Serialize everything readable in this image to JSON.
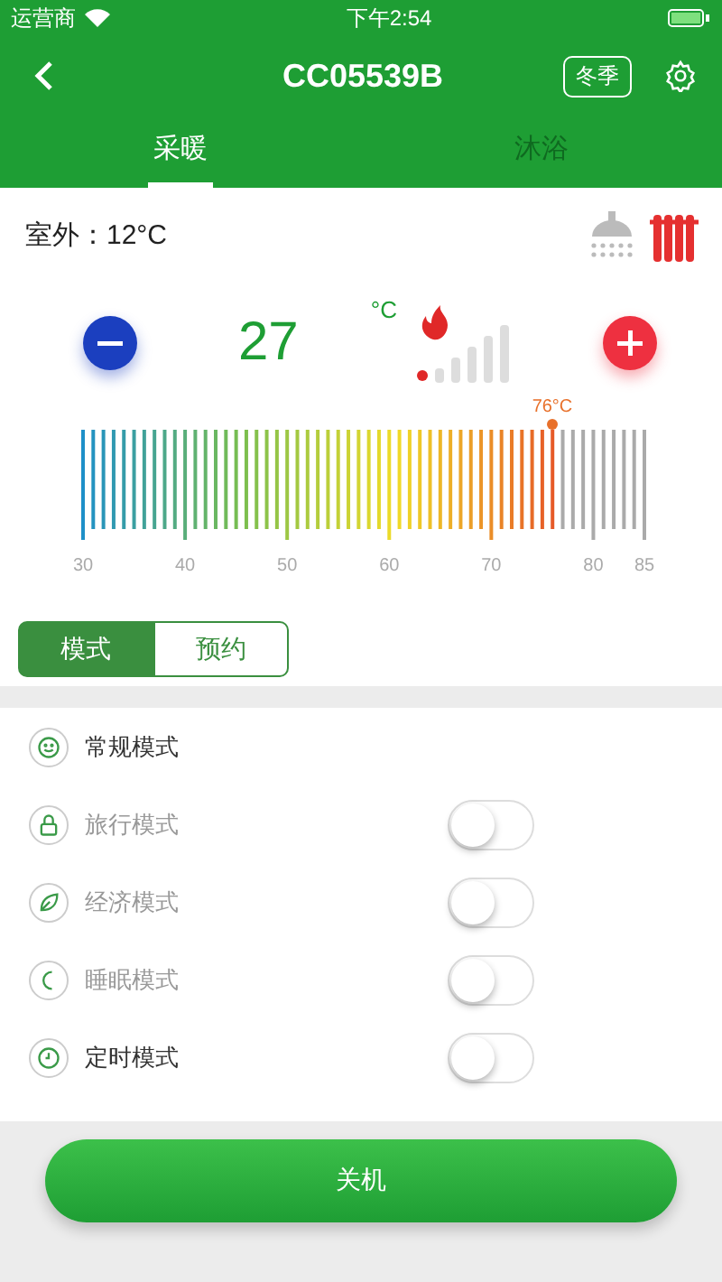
{
  "status_bar": {
    "carrier": "运营商",
    "time": "下午2:54"
  },
  "header": {
    "title": "CC05539B",
    "season": "冬季"
  },
  "tabs": [
    {
      "label": "采暖",
      "selected": true
    },
    {
      "label": "沐浴",
      "selected": false
    }
  ],
  "outdoor": {
    "label": "室外：",
    "value": "12°C"
  },
  "indicators": [
    {
      "kind": "shower",
      "active": false
    },
    {
      "kind": "radiator",
      "active": true
    }
  ],
  "setpoint": {
    "value": "27",
    "unit": "°C"
  },
  "gauge": {
    "level": 0.836,
    "reading": "76°C",
    "ticks": [
      "30",
      "40",
      "50",
      "60",
      "70",
      "80",
      "85"
    ]
  },
  "segments": [
    {
      "label": "模式",
      "selected": true
    },
    {
      "label": "预约",
      "selected": false
    }
  ],
  "modes": [
    {
      "kind": "plain",
      "label": "常规模式",
      "disabled": false
    },
    {
      "kind": "toggle",
      "label": "旅行模式",
      "disabled": true,
      "on": false
    },
    {
      "kind": "toggle",
      "label": "经济模式",
      "disabled": true,
      "on": false
    },
    {
      "kind": "toggle",
      "label": "睡眠模式",
      "disabled": true,
      "on": false
    },
    {
      "kind": "toggle",
      "label": "定时模式",
      "disabled": false,
      "on": false
    }
  ],
  "power_button": "关机"
}
